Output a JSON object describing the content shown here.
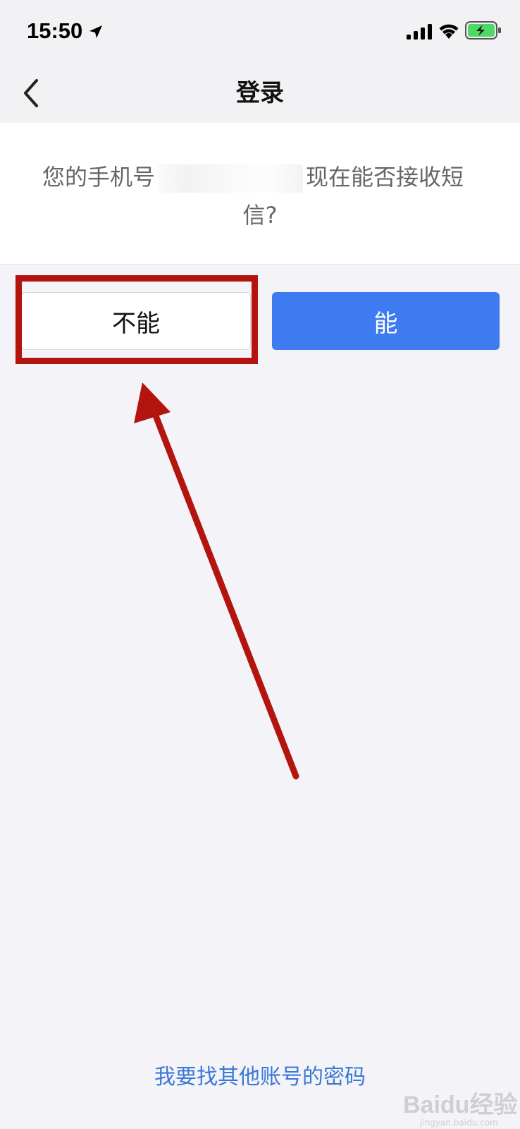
{
  "status_bar": {
    "time": "15:50",
    "icons": [
      "location-arrow-icon",
      "cellular-signal-icon",
      "wifi-icon",
      "battery-charging-icon"
    ],
    "battery_color": "#4cd964"
  },
  "nav": {
    "title": "登录",
    "back_icon": "chevron-left-icon"
  },
  "message": {
    "prefix": "您的手机号",
    "suffix": "现在能否接收短",
    "line2": "信?"
  },
  "buttons": {
    "no_label": "不能",
    "yes_label": "能",
    "yes_color": "#3e7af0"
  },
  "annotation": {
    "highlight_color": "#b3150e"
  },
  "footer": {
    "link_label": "我要找其他账号的密码",
    "link_color": "#3a78d8"
  },
  "watermark": {
    "brand": "Baidu经验",
    "url": "jingyan.baidu.com"
  }
}
